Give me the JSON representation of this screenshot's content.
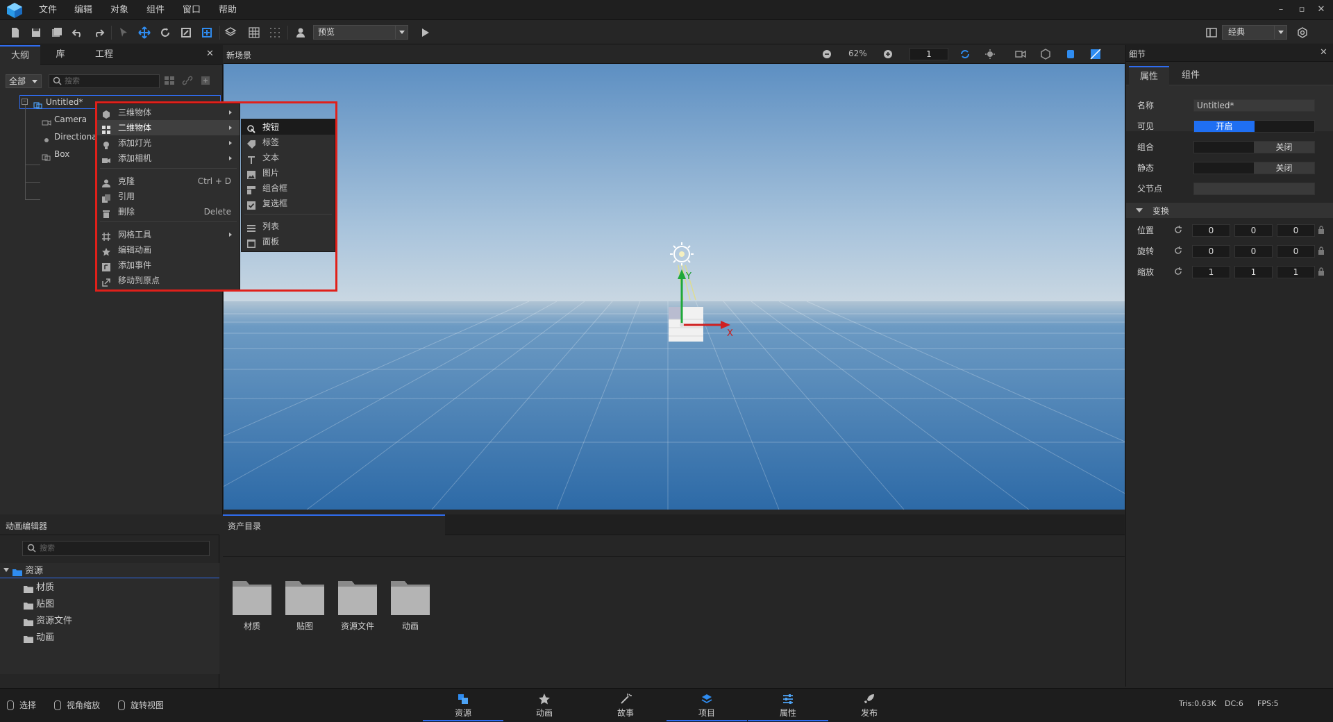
{
  "menubar": {
    "items": [
      "文件",
      "编辑",
      "对象",
      "组件",
      "窗口",
      "帮助"
    ]
  },
  "toolbar": {
    "preview_select": "预览",
    "layout_select": "经典"
  },
  "outline": {
    "tabs": [
      "大纲",
      "库",
      "工程"
    ],
    "filter": "全部",
    "search_placeholder": "搜索",
    "tree": [
      "Untitled*",
      "Camera",
      "Directional",
      "Box"
    ]
  },
  "context_menu": {
    "items": [
      {
        "label": "三维物体",
        "submenu": true
      },
      {
        "label": "二维物体",
        "submenu": true,
        "highlighted": true
      },
      {
        "label": "添加灯光",
        "submenu": true
      },
      {
        "label": "添加相机",
        "submenu": true
      },
      {
        "label": "克隆",
        "shortcut": "Ctrl + D"
      },
      {
        "label": "引用"
      },
      {
        "label": "删除",
        "shortcut": "Delete"
      },
      {
        "label": "网格工具",
        "submenu": true
      },
      {
        "label": "编辑动画"
      },
      {
        "label": "添加事件"
      },
      {
        "label": "移动到原点"
      }
    ],
    "submenu": [
      "按钮",
      "标签",
      "文本",
      "图片",
      "组合框",
      "复选框",
      "列表",
      "面板"
    ]
  },
  "scene": {
    "title": "新场景",
    "zoom": "62%",
    "layer": "1",
    "axis_x": "X",
    "axis_y": "Y"
  },
  "details": {
    "title": "细节",
    "tabs": [
      "属性",
      "组件"
    ],
    "name_label": "名称",
    "name_value": "Untitled*",
    "visible_label": "可见",
    "visible_value": "开启",
    "group_label": "组合",
    "group_value": "关闭",
    "static_label": "静态",
    "static_value": "关闭",
    "parent_label": "父节点",
    "transform_section": "变换",
    "position_label": "位置",
    "rotation_label": "旋转",
    "scale_label": "缩放",
    "position": [
      "0",
      "0",
      "0"
    ],
    "rotation": [
      "0",
      "0",
      "0"
    ],
    "scale": [
      "1",
      "1",
      "1"
    ]
  },
  "anim_editor": {
    "title": "动画编辑器",
    "search_placeholder": "搜索",
    "root": "资源",
    "children": [
      "材质",
      "贴图",
      "资源文件",
      "动画"
    ]
  },
  "assets": {
    "title": "资产目录",
    "folders": [
      "材质",
      "贴图",
      "资源文件",
      "动画"
    ]
  },
  "statusbar": {
    "modes": [
      "选择",
      "视角缩放",
      "旋转视图"
    ],
    "nav": [
      "资源",
      "动画",
      "故事",
      "项目",
      "属性",
      "发布"
    ],
    "tris": "Tris:0.63K",
    "dc": "DC:6",
    "fps": "FPS:5"
  },
  "colors": {
    "accent": "#1f6ff2",
    "highlight_box": "#e0201a"
  }
}
